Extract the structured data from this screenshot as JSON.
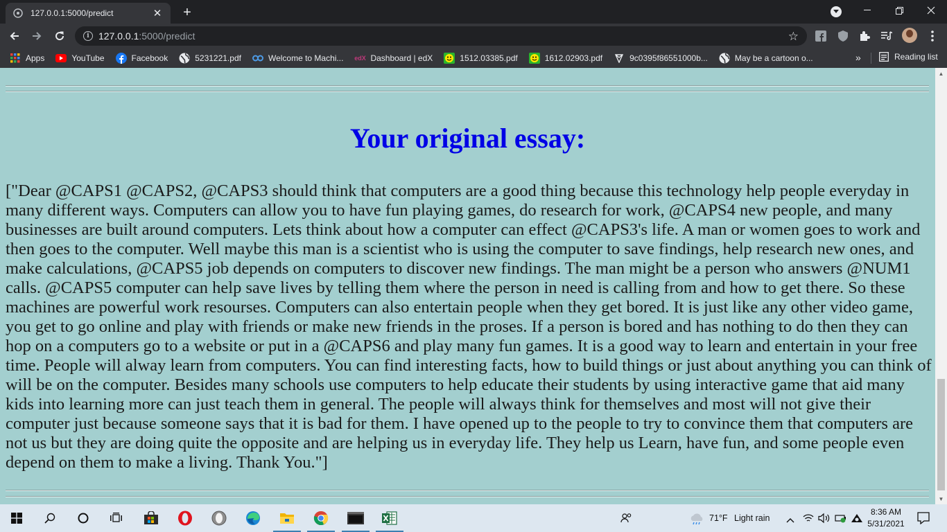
{
  "browser": {
    "tab": {
      "title": "127.0.0.1:5000/predict",
      "close": "✕"
    },
    "new_tab": "+",
    "window": {
      "minimize": "—",
      "restore": "❐",
      "close": "✕"
    },
    "address": {
      "host": "127.0.0.1",
      "path": ":5000/predict"
    },
    "bookmarks": [
      {
        "label": "Apps",
        "icon": "apps-grid-icon"
      },
      {
        "label": "YouTube",
        "icon": "youtube-icon"
      },
      {
        "label": "Facebook",
        "icon": "facebook-icon"
      },
      {
        "label": "5231221.pdf",
        "icon": "globe-icon"
      },
      {
        "label": "Welcome to Machi...",
        "icon": "coursera-icon"
      },
      {
        "label": "Dashboard | edX",
        "icon": "edx-icon"
      },
      {
        "label": "1512.03385.pdf",
        "icon": "smiley-icon"
      },
      {
        "label": "1612.02903.pdf",
        "icon": "smiley-icon"
      },
      {
        "label": "9c0395f86551000b...",
        "icon": "diamond-icon"
      },
      {
        "label": "May be a cartoon o...",
        "icon": "globe-icon"
      }
    ],
    "bookmarks_overflow": "»",
    "reading_list": "Reading list"
  },
  "page": {
    "heading": "Your original essay:",
    "essay": "[\"Dear @CAPS1 @CAPS2, @CAPS3 should think that computers are a good thing because this technology help people everyday in many different ways. Computers can allow you to have fun playing games, do research for work, @CAPS4 new people, and many businesses are built around computers. Lets think about how a computer can effect @CAPS3's life. A man or women goes to work and then goes to the computer. Well maybe this man is a scientist who is using the computer to save findings, help research new ones, and make calculations, @CAPS5 job depends on computers to discover new findings. The man might be a person who answers @NUM1 calls. @CAPS5 computer can help save lives by telling them where the person in need is calling from and how to get there. So these machines are powerful work resourses. Computers can also entertain people when they get bored. It is just like any other video game, you get to go online and play with friends or make new friends in the proses. If a person is bored and has nothing to do then they can hop on a computers go to a website or put in a @CAPS6 and play many fun games. It is a good way to learn and entertain in your free time. People will alway learn from computers. You can find interesting facts, how to build things or just about anything you can think of will be on the computer. Besides many schools use computers to help educate their students by using interactive game that aid many kids into learning more can just teach them in general. The people will always think for themselves and most will not give their computer just because someone says that it is bad for them. I have opened up to the people to try to convince them that computers are not us but they are doing quite the opposite and are helping us in everyday life. They help us Learn, have fun, and some people even depend on them to make a living. Thank You.\"]"
  },
  "taskbar": {
    "weather": {
      "temp": "71°F",
      "condition": "Light rain"
    },
    "clock": {
      "time": "8:36 AM",
      "date": "5/31/2021"
    }
  },
  "colors": {
    "page_bg": "#a3cfcf",
    "heading": "#0000e6",
    "chrome_dark": "#202124",
    "chrome_toolbar": "#35363a"
  }
}
